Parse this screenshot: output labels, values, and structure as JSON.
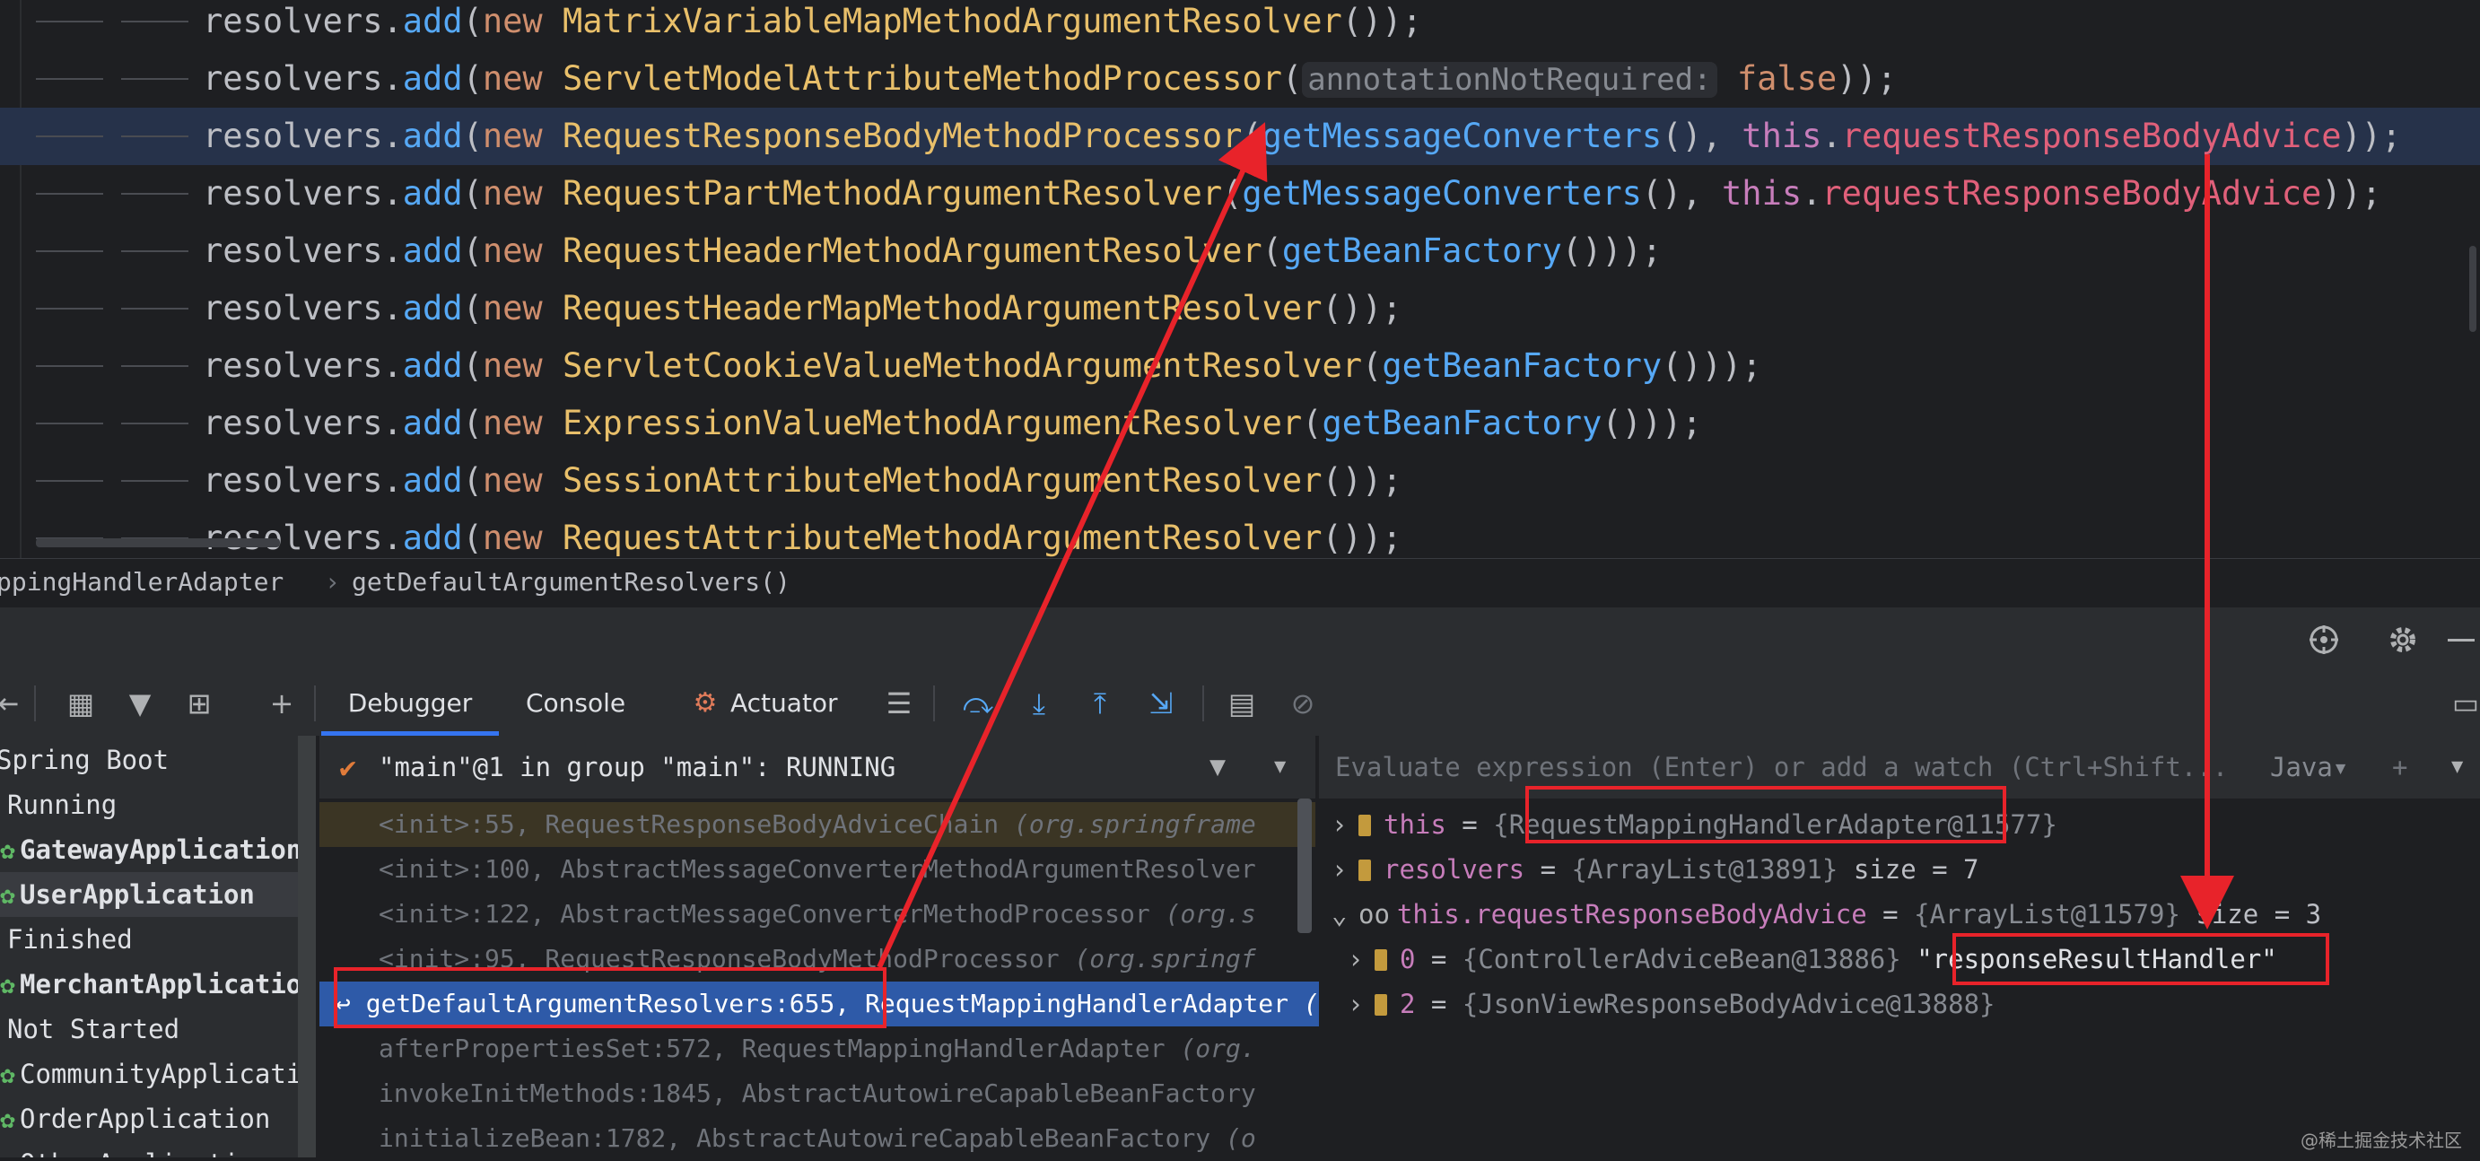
{
  "editor": {
    "lines": [
      {
        "obj": "resolvers",
        "dot": ".",
        "method": "add",
        "open": "(",
        "kw": "new",
        "cls": "MatrixVariableMapMethodArgumentResolver",
        "rest": "());"
      },
      {
        "obj": "resolvers",
        "dot": ".",
        "method": "add",
        "open": "(",
        "kw": "new",
        "cls": "ServletModelAttributeMethodProcessor",
        "hint": "annotationNotRequired:",
        "bool": "false",
        "rest": "));"
      },
      {
        "obj": "resolvers",
        "dot": ".",
        "method": "add",
        "open": "(",
        "kw": "new",
        "cls": "RequestResponseBodyMethodProcessor",
        "arg1": "getMessageConverters",
        "arg1p": "(), ",
        "this": "this",
        "field": "requestResponseBodyAdvice",
        "rest": "));"
      },
      {
        "obj": "resolvers",
        "dot": ".",
        "method": "add",
        "open": "(",
        "kw": "new",
        "cls": "RequestPartMethodArgumentResolver",
        "arg1": "getMessageConverters",
        "arg1p": "(), ",
        "this": "this",
        "field": "requestResponseBodyAdvice",
        "rest": "));"
      },
      {
        "obj": "resolvers",
        "dot": ".",
        "method": "add",
        "open": "(",
        "kw": "new",
        "cls": "RequestHeaderMethodArgumentResolver",
        "arg1": "getBeanFactory",
        "rest": "()));"
      },
      {
        "obj": "resolvers",
        "dot": ".",
        "method": "add",
        "open": "(",
        "kw": "new",
        "cls": "RequestHeaderMapMethodArgumentResolver",
        "rest": "());"
      },
      {
        "obj": "resolvers",
        "dot": ".",
        "method": "add",
        "open": "(",
        "kw": "new",
        "cls": "ServletCookieValueMethodArgumentResolver",
        "arg1": "getBeanFactory",
        "rest": "()));"
      },
      {
        "obj": "resolvers",
        "dot": ".",
        "method": "add",
        "open": "(",
        "kw": "new",
        "cls": "ExpressionValueMethodArgumentResolver",
        "arg1": "getBeanFactory",
        "rest": "()));"
      },
      {
        "obj": "resolvers",
        "dot": ".",
        "method": "add",
        "open": "(",
        "kw": "new",
        "cls": "SessionAttributeMethodArgumentResolver",
        "rest": "());"
      },
      {
        "obj": "resolvers",
        "dot": ".",
        "method": "add",
        "open": "(",
        "kw": "new",
        "cls": "RequestAttributeMethodArgumentResolver",
        "rest": "());"
      }
    ]
  },
  "breadcrumb": {
    "class": "ppingHandlerAdapter",
    "separator": "›",
    "method": "getDefaultArgumentResolvers()"
  },
  "toolbar": {
    "tabs": [
      "Debugger",
      "Console",
      "Actuator"
    ]
  },
  "services": {
    "items": [
      {
        "label": "Spring Boot",
        "icon": ""
      },
      {
        "label": "Running",
        "icon": ""
      },
      {
        "label": "GatewayApplication",
        "icon": "spring-run"
      },
      {
        "label": "UserApplication",
        "icon": "spring-run"
      },
      {
        "label": "Finished",
        "icon": ""
      },
      {
        "label": "MerchantApplicatio",
        "icon": "spring"
      },
      {
        "label": "Not Started",
        "icon": ""
      },
      {
        "label": "CommunityApplicati",
        "icon": "spring"
      },
      {
        "label": "OrderApplication",
        "icon": "spring"
      },
      {
        "label": "OtherApplication",
        "icon": "spring"
      }
    ]
  },
  "thread": {
    "label": "\"main\"@1 in group \"main\": RUNNING"
  },
  "frames": [
    {
      "method": "<init>:55, RequestResponseBodyAdviceChain",
      "pkg": "(org.springframe"
    },
    {
      "method": "<init>:100, AbstractMessageConverterMethodArgumentResolver",
      "pkg": ""
    },
    {
      "method": "<init>:122, AbstractMessageConverterMethodProcessor",
      "pkg": "(org.s"
    },
    {
      "method": "<init>:95, RequestResponseBodyMethodProcessor",
      "pkg": "(org.springf"
    },
    {
      "method": "getDefaultArgumentResolvers:655,",
      "cls": "RequestMappingHandlerAdapter",
      "pkg": "(org.springframework.web.servlet.mvc.method.annotation)"
    },
    {
      "method": "afterPropertiesSet:572, RequestMappingHandlerAdapter",
      "pkg": "(org."
    },
    {
      "method": "invokeInitMethods:1845, AbstractAutowireCapableBeanFactory",
      "pkg": ""
    },
    {
      "method": "initializeBean:1782, AbstractAutowireCapableBeanFactory",
      "pkg": "(o"
    }
  ],
  "evaluate": {
    "placeholder": "Evaluate expression (Enter) or add a watch (Ctrl+Shift...",
    "lang": "Java"
  },
  "variables": [
    {
      "name": "this",
      "value": "{RequestMappingHandlerAdapter@11577}",
      "extra": ""
    },
    {
      "name": "resolvers",
      "value": "{ArrayList@13891}",
      "extra": "size = 7"
    },
    {
      "name": "this.requestResponseBodyAdvice",
      "value": "{ArrayList@11579}",
      "extra": "size = 3"
    },
    {
      "name": "0",
      "value": "{ControllerAdviceBean@13886}",
      "extra": "\"responseResultHandler\""
    },
    {
      "name": "2",
      "value": "{JsonViewResponseBodyAdvice@13888}",
      "extra": ""
    }
  ],
  "watermark": "@稀土掘金技术社区",
  "colors": {
    "annotation": "#e8232a",
    "selection": "#2e5aa8",
    "accent": "#3574f0"
  }
}
